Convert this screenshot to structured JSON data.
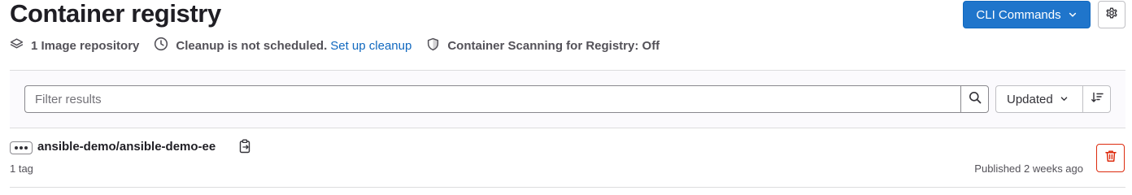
{
  "header": {
    "title": "Container registry",
    "cli_button_label": "CLI Commands"
  },
  "meta": {
    "image_repositories": "1 Image repository",
    "cleanup_status": "Cleanup is not scheduled.",
    "cleanup_link": "Set up cleanup",
    "scanning_status": "Container Scanning for Registry: Off"
  },
  "filter": {
    "placeholder": "Filter results",
    "value": "",
    "sort_selected": "Updated"
  },
  "repositories": [
    {
      "name": "ansible-demo/ansible-demo-ee",
      "tags": "1 tag",
      "published": "Published 2 weeks ago"
    }
  ],
  "colors": {
    "primary": "#1f75cb",
    "danger": "#dd2b0e",
    "link": "#1068bf"
  }
}
